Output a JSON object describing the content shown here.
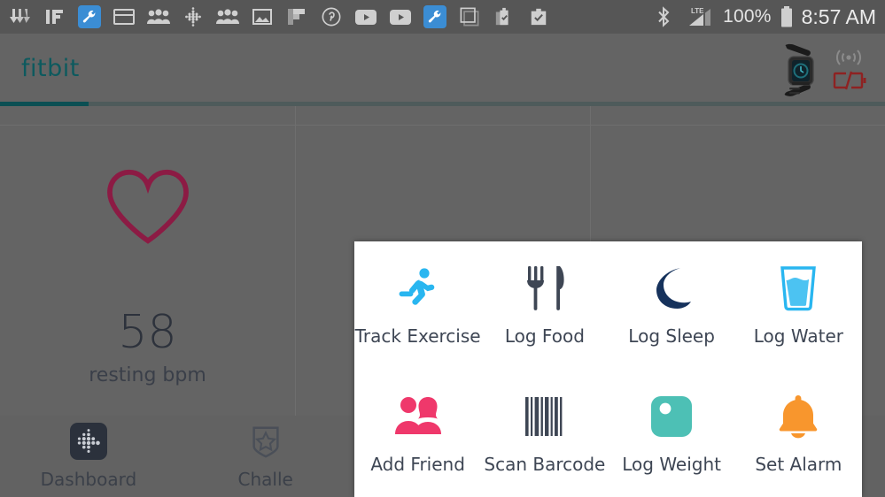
{
  "status_bar": {
    "notification_icons": [
      {
        "name": "download-icon",
        "glyph": "download"
      },
      {
        "name": "ifttt-icon",
        "glyph": "IF"
      },
      {
        "name": "wrench-badge-icon",
        "glyph": "wrench"
      },
      {
        "name": "card-icon",
        "glyph": "card"
      },
      {
        "name": "people-icon",
        "glyph": "people"
      },
      {
        "name": "fitbit-dots-icon",
        "glyph": "dots"
      },
      {
        "name": "people-icon-2",
        "glyph": "people"
      },
      {
        "name": "photo-icon",
        "glyph": "photo"
      },
      {
        "name": "flipboard-icon",
        "glyph": "flipboard"
      },
      {
        "name": "pinterest-icon",
        "glyph": "pinterest"
      },
      {
        "name": "youtube-icon",
        "glyph": "youtube"
      },
      {
        "name": "youtube-icon-2",
        "glyph": "youtube"
      },
      {
        "name": "wrench-badge-icon-2",
        "glyph": "wrench"
      },
      {
        "name": "google-plus-icon",
        "glyph": "gplus"
      },
      {
        "name": "tasks-icon",
        "glyph": "tasks"
      },
      {
        "name": "task-icon",
        "glyph": "task"
      }
    ],
    "bluetooth": "bluetooth-icon",
    "network_type": "LTE",
    "signal": "signal-icon",
    "battery_percent": "100%",
    "battery_icon": "battery-full-icon",
    "time": "8:57 AM"
  },
  "header": {
    "brand": "fitbit",
    "brand_color": "#0d5a5e",
    "device_icon": "fitbit-blaze-watch",
    "sync_icon": "sync-waves-icon",
    "device_battery_icon": "battery-empty-icon",
    "device_battery_color": "#8e2222"
  },
  "tabs": {
    "active_indicator_color": "#0b4f53"
  },
  "heart_rate_card": {
    "icon": "heart-outline-icon",
    "icon_color": "#8c1b44",
    "value": "58",
    "label": "resting bpm"
  },
  "bottom_nav": {
    "items": [
      {
        "label": "Dashboard",
        "icon": "fitbit-dots-logo-icon",
        "active": true
      },
      {
        "label": "Challe",
        "icon": "star-badge-icon",
        "active": false
      }
    ]
  },
  "quick_menu": {
    "items": [
      {
        "label": "Track Exercise",
        "icon": "running-person-icon",
        "color": "#29b6f0"
      },
      {
        "label": "Log Food",
        "icon": "fork-knife-icon",
        "color": "#3e4654"
      },
      {
        "label": "Log Sleep",
        "icon": "crescent-moon-icon",
        "color": "#16325c"
      },
      {
        "label": "Log Water",
        "icon": "water-glass-icon",
        "color": "#29b6f0"
      },
      {
        "label": "Add Friend",
        "icon": "two-people-icon",
        "color": "#ef386b"
      },
      {
        "label": "Scan Barcode",
        "icon": "barcode-icon",
        "color": "#3e4654"
      },
      {
        "label": "Log Weight",
        "icon": "scale-icon",
        "color": "#4dc0b5"
      },
      {
        "label": "Set Alarm",
        "icon": "bell-icon",
        "color": "#f8962d"
      }
    ]
  }
}
